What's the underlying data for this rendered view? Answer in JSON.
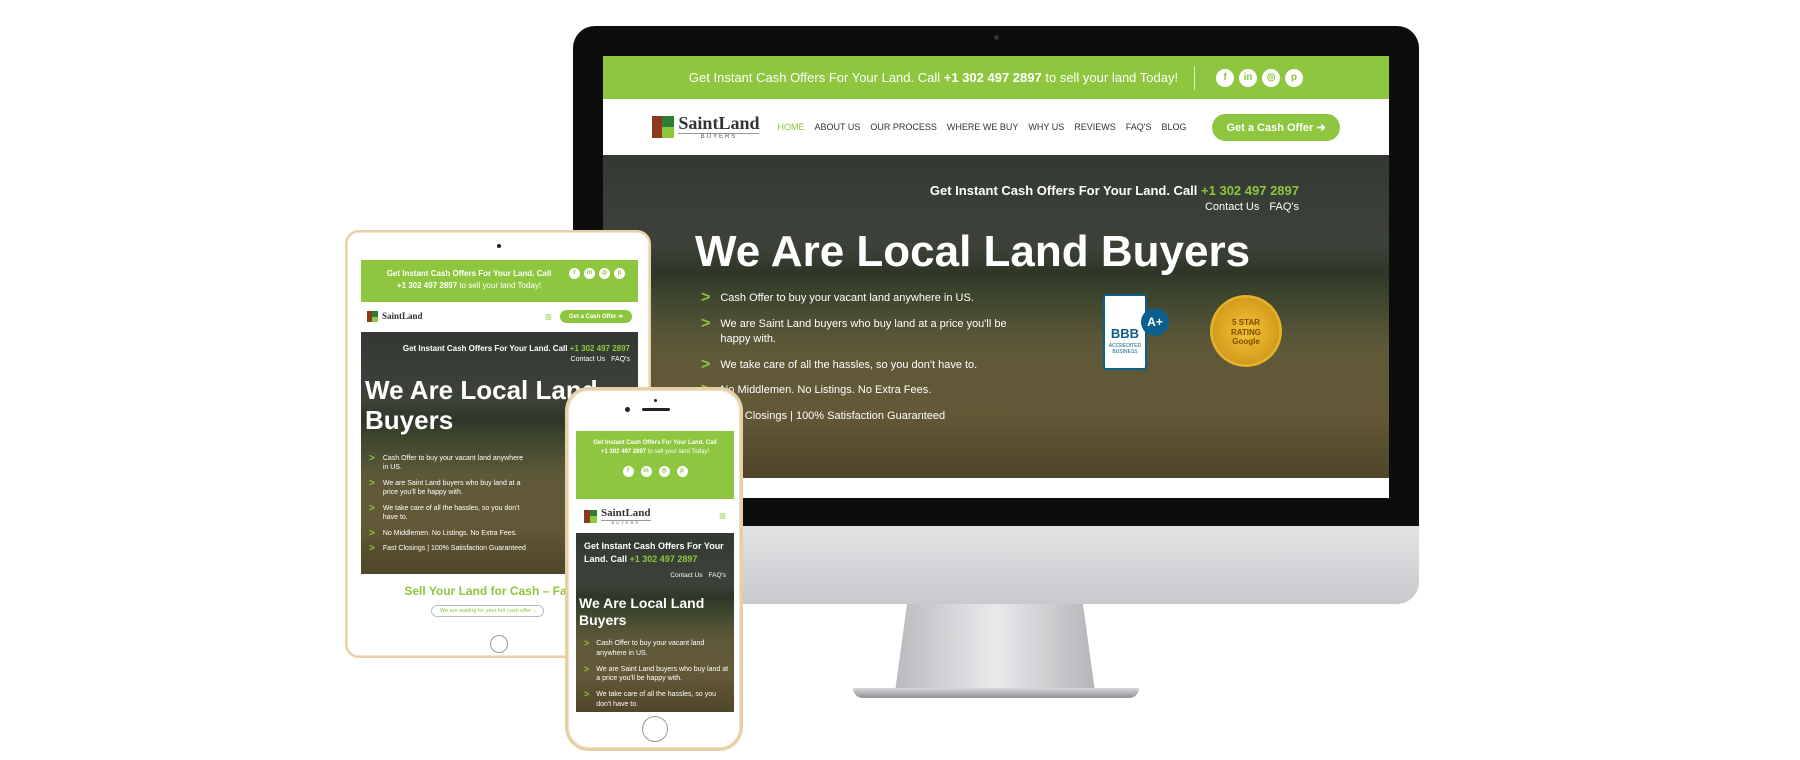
{
  "brand": {
    "name_part1": "Saint",
    "name_part2": "Land",
    "tagline": "BUYERS",
    "accent_color": "#8ec63f"
  },
  "topbar": {
    "text_before": "Get Instant Cash Offers For Your Land. Call",
    "phone": "+1 302 497 2897",
    "text_after": "to sell your land Today!",
    "social_icons": [
      "facebook-icon",
      "linkedin-icon",
      "instagram-icon",
      "pinterest-icon"
    ]
  },
  "nav": {
    "items": [
      "HOME",
      "ABOUT US",
      "OUR PROCESS",
      "WHERE WE BUY",
      "WHY US",
      "REVIEWS",
      "FAQ'S",
      "BLOG"
    ],
    "cta": "Get a Cash Offer"
  },
  "hero": {
    "offer_line": "Get Instant Cash Offers For Your Land. Call",
    "phone": "+1 302 497 2897",
    "contact_link": "Contact Us",
    "faq_link": "FAQ's",
    "title": "We Are Local Land Buyers",
    "title_line1": "We Are Local Land",
    "title_line2": "Buyers",
    "bullets": [
      "Cash Offer to buy your vacant land anywhere in US.",
      "We are Saint Land buyers who buy land at a price you'll be happy with.",
      "We take care of all the hassles, so you don't have to.",
      "No Middlemen. No Listings. No Extra Fees.",
      "Fast Closings | 100% Satisfaction Guaranteed"
    ],
    "bbb_badge": {
      "letters": "BBB",
      "grade": "A+",
      "caption": "ACCREDITED BUSINESS"
    },
    "google_badge": {
      "line1": "5 STAR",
      "line2": "RATING",
      "line3": "Google"
    }
  },
  "tablet": {
    "sell_heading": "Sell Your Land for Cash – Fast an",
    "waiting_button": "We are waiting for your fair cash offer ↓"
  }
}
